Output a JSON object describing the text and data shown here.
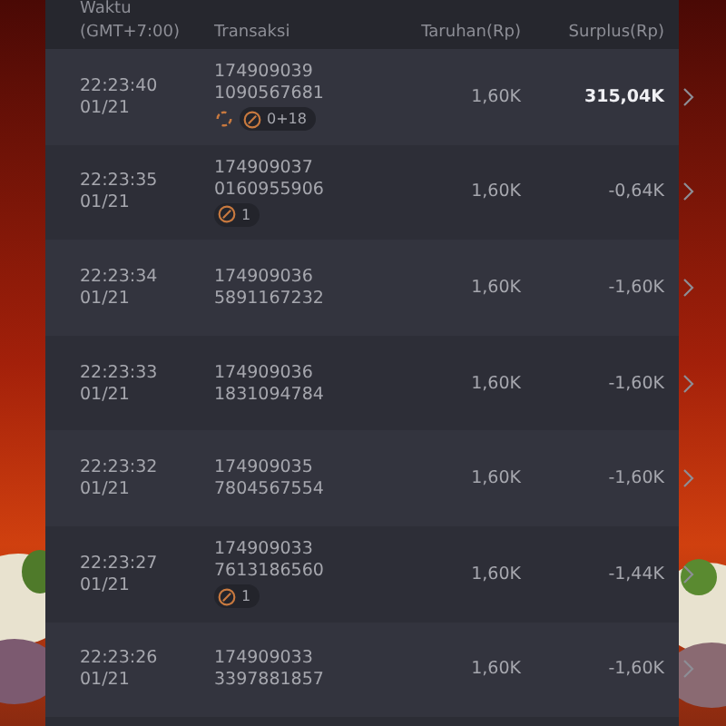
{
  "header": {
    "time_label": "Waktu",
    "timezone": "(GMT+7:00)",
    "transaction": "Transaksi",
    "bet": "Taruhan(Rp)",
    "surplus": "Surplus(Rp)"
  },
  "rows": [
    {
      "time": "22:23:40",
      "date": "01/21",
      "id_1": "174909039",
      "id_2": "1090567681",
      "respin": true,
      "feature": "0+18",
      "bet": "1,60K",
      "surplus": "315,04K",
      "positive": true
    },
    {
      "time": "22:23:35",
      "date": "01/21",
      "id_1": "174909037",
      "id_2": "0160955906",
      "respin": false,
      "feature": "1",
      "bet": "1,60K",
      "surplus": "-0,64K",
      "positive": false
    },
    {
      "time": "22:23:34",
      "date": "01/21",
      "id_1": "174909036",
      "id_2": "5891167232",
      "respin": false,
      "bet": "1,60K",
      "surplus": "-1,60K",
      "positive": false
    },
    {
      "time": "22:23:33",
      "date": "01/21",
      "id_1": "174909036",
      "id_2": "1831094784",
      "respin": false,
      "bet": "1,60K",
      "surplus": "-1,60K",
      "positive": false
    },
    {
      "time": "22:23:32",
      "date": "01/21",
      "id_1": "174909035",
      "id_2": "7804567554",
      "respin": false,
      "bet": "1,60K",
      "surplus": "-1,60K",
      "positive": false
    },
    {
      "time": "22:23:27",
      "date": "01/21",
      "id_1": "174909033",
      "id_2": "7613186560",
      "respin": false,
      "feature": "1",
      "bet": "1,60K",
      "surplus": "-1,44K",
      "positive": false
    },
    {
      "time": "22:23:26",
      "date": "01/21",
      "id_1": "174909033",
      "id_2": "3397881857",
      "respin": false,
      "bet": "1,60K",
      "surplus": "-1,60K",
      "positive": false
    }
  ]
}
